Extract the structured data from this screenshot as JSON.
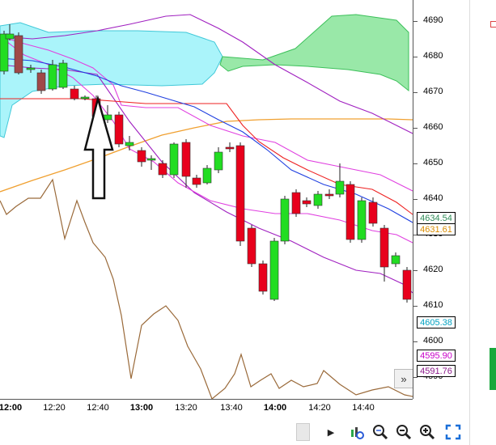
{
  "price_axis": {
    "ticks": [
      "4690",
      "4680",
      "4670",
      "4660",
      "4650",
      "4640",
      "4630",
      "4620",
      "4610",
      "4600",
      "4590"
    ],
    "badges": [
      {
        "label": "4634.54",
        "color": "#2e8b57"
      },
      {
        "label": "4631.61",
        "color": "#d98c00"
      },
      {
        "label": "4605.38",
        "color": "#00a0c0"
      },
      {
        "label": "4595.90",
        "color": "#c800c8"
      },
      {
        "label": "4591.76",
        "color": "#8b1a8b"
      }
    ]
  },
  "time_axis": {
    "labels": [
      {
        "text": "12:00",
        "bold": true
      },
      {
        "text": "12:20",
        "bold": false
      },
      {
        "text": "12:40",
        "bold": false
      },
      {
        "text": "13:00",
        "bold": true
      },
      {
        "text": "13:20",
        "bold": false
      },
      {
        "text": "13:40",
        "bold": false
      },
      {
        "text": "14:00",
        "bold": true
      },
      {
        "text": "14:20",
        "bold": false
      },
      {
        "text": "14:40",
        "bold": false
      }
    ]
  },
  "controls": {
    "scroll_right_glyph": "»",
    "play_glyph": "▶"
  },
  "colors": {
    "up_candle": "#22dd22",
    "down_candle": "#e8001c",
    "cloud_blue": "#aaf4fa",
    "cloud_green": "#99e8a8",
    "blue_line": "#2040e0",
    "red_line": "#ee2222",
    "orange_line": "#f0a030",
    "brown_line": "#9a6a3a",
    "magenta_band": "#e040e0",
    "purple_band": "#a020c0"
  },
  "icons": [
    "scroll-right-icon",
    "play-icon",
    "chart-settings-icon",
    "zoom-fit-icon",
    "zoom-out-icon",
    "zoom-in-icon",
    "fullscreen-icon"
  ]
}
